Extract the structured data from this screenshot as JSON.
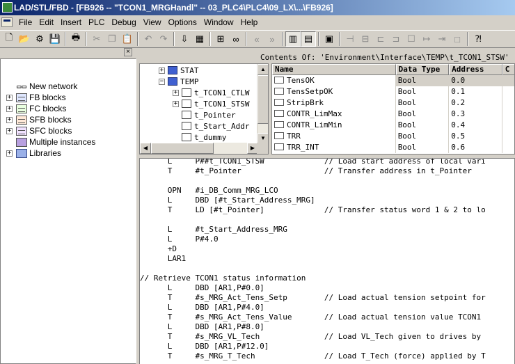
{
  "window": {
    "title": "LAD/STL/FBD  - [FB926 -- \"TCON1_MRGHandl\" -- 03_PLC4\\PLC4\\09_LX\\...\\FB926]"
  },
  "menu": {
    "items": [
      "File",
      "Edit",
      "Insert",
      "PLC",
      "Debug",
      "View",
      "Options",
      "Window",
      "Help"
    ]
  },
  "toolbar": {
    "buttons": [
      {
        "name": "new-icon",
        "glyph": "🗋"
      },
      {
        "name": "open-icon",
        "glyph": "📂"
      },
      {
        "name": "accessible-nodes-icon",
        "glyph": "⚙"
      },
      {
        "name": "save-icon",
        "glyph": "💾"
      },
      {
        "sep": true
      },
      {
        "name": "print-icon",
        "glyph": "🖶"
      },
      {
        "sep": true
      },
      {
        "name": "cut-icon",
        "glyph": "✂",
        "dim": true
      },
      {
        "name": "copy-icon",
        "glyph": "❐",
        "dim": true
      },
      {
        "name": "paste-icon",
        "glyph": "📋"
      },
      {
        "sep": true
      },
      {
        "name": "undo-icon",
        "glyph": "↶",
        "dim": true
      },
      {
        "name": "redo-icon",
        "glyph": "↷",
        "dim": true
      },
      {
        "sep": true
      },
      {
        "name": "download-icon",
        "glyph": "⇩"
      },
      {
        "name": "online-icon",
        "glyph": "▦"
      },
      {
        "sep": true
      },
      {
        "name": "network-icon",
        "glyph": "⊞"
      },
      {
        "name": "monitor-icon",
        "glyph": "∞"
      },
      {
        "sep": true
      },
      {
        "name": "prev-network-icon",
        "glyph": "«",
        "dim": true
      },
      {
        "name": "next-network-icon",
        "glyph": "»",
        "dim": true
      },
      {
        "sep": true
      },
      {
        "name": "overview-icon",
        "glyph": "▥",
        "pressed": true
      },
      {
        "name": "details-icon",
        "glyph": "▤",
        "pressed": true
      },
      {
        "sep": true
      },
      {
        "name": "new-network-icon",
        "glyph": "▣"
      },
      {
        "sep": true
      },
      {
        "name": "contact-icon",
        "glyph": "⊣",
        "dim": true
      },
      {
        "name": "coil-icon",
        "glyph": "⊟",
        "dim": true
      },
      {
        "name": "branch-open-icon",
        "glyph": "⊏",
        "dim": true
      },
      {
        "name": "branch-close-icon",
        "glyph": "⊐",
        "dim": true
      },
      {
        "name": "box-icon",
        "glyph": "☐",
        "dim": true
      },
      {
        "name": "arrow-icon",
        "glyph": "↦",
        "dim": true
      },
      {
        "name": "line-icon",
        "glyph": "⇥",
        "dim": true
      },
      {
        "name": "empty-box-icon",
        "glyph": "□",
        "dim": true
      },
      {
        "sep": true
      },
      {
        "name": "help-icon",
        "glyph": "⁈"
      }
    ]
  },
  "left_tree": {
    "close_label": "×",
    "items": [
      {
        "label": "New network",
        "icon": "new-network-icon",
        "expander": ""
      },
      {
        "label": "FB blocks",
        "icon": "fb-blocks-icon",
        "expander": "+"
      },
      {
        "label": "FC blocks",
        "icon": "fc-blocks-icon",
        "expander": "+"
      },
      {
        "label": "SFB blocks",
        "icon": "sfb-blocks-icon",
        "expander": "+"
      },
      {
        "label": "SFC blocks",
        "icon": "sfc-blocks-icon",
        "expander": "+"
      },
      {
        "label": "Multiple instances",
        "icon": "multiple-instances-icon",
        "expander": ""
      },
      {
        "label": "Libraries",
        "icon": "libraries-icon",
        "expander": "+"
      }
    ]
  },
  "interface_tree": {
    "items": [
      {
        "label": "STAT",
        "expander": "+",
        "indent": 0,
        "icon": "stat-icon"
      },
      {
        "label": "TEMP",
        "expander": "−",
        "indent": 0,
        "icon": "temp-icon"
      },
      {
        "label": "t_TCON1_CTLW",
        "expander": "+",
        "indent": 1,
        "icon": "struct-icon"
      },
      {
        "label": "t_TCON1_STSW",
        "expander": "+",
        "indent": 1,
        "icon": "struct-icon"
      },
      {
        "label": "t_Pointer",
        "expander": "",
        "indent": 1,
        "icon": "variable-icon"
      },
      {
        "label": "t_Start_Addr",
        "expander": "",
        "indent": 1,
        "icon": "variable-icon"
      },
      {
        "label": "t_dummy",
        "expander": "",
        "indent": 1,
        "icon": "variable-icon"
      }
    ]
  },
  "contents": {
    "label": "Contents Of: 'Environment\\Interface\\TEMP\\t_TCON1_STSW'",
    "columns": [
      "Name",
      "Data Type",
      "Address",
      "C"
    ],
    "rows": [
      {
        "name": "TensOK",
        "type": "Bool",
        "address": "0.0",
        "selected": true
      },
      {
        "name": "TensSetpOK",
        "type": "Bool",
        "address": "0.1"
      },
      {
        "name": "StripBrk",
        "type": "Bool",
        "address": "0.2"
      },
      {
        "name": "CONTR_LimMax",
        "type": "Bool",
        "address": "0.3"
      },
      {
        "name": "CONTR_LimMin",
        "type": "Bool",
        "address": "0.4"
      },
      {
        "name": "TRR",
        "type": "Bool",
        "address": "0.5"
      },
      {
        "name": "TRR_INT",
        "type": "Bool",
        "address": "0.6"
      }
    ]
  },
  "code": {
    "lines": [
      "      L     P##t_TCON1_STSW             // Load start address of local vari",
      "      T     #t_Pointer                  // Transfer address in t_Pointer",
      "",
      "      OPN   #i_DB_Comm_MRG_LCO",
      "      L     DBD [#t_Start_Address_MRG]",
      "      T     LD [#t_Pointer]             // Transfer status word 1 & 2 to lo",
      "",
      "      L     #t_Start_Address_MRG",
      "      L     P#4.0",
      "      +D",
      "      LAR1",
      "",
      "// Retrieve TCON1 status information",
      "      L     DBD [AR1,P#0.0]",
      "      T     #s_MRG_Act_Tens_Setp        // Load actual tension setpoint for",
      "      L     DBD [AR1,P#4.0]",
      "      T     #s_MRG_Act_Tens_Value       // Load actual tension value TCON1",
      "      L     DBD [AR1,P#8.0]",
      "      T     #s_MRG_VL_Tech              // Load VL_Tech given to drives by",
      "      L     DBD [AR1,P#12.0]",
      "      T     #s_MRG_T_Tech               // Load T_Tech (force) applied by T"
    ]
  }
}
